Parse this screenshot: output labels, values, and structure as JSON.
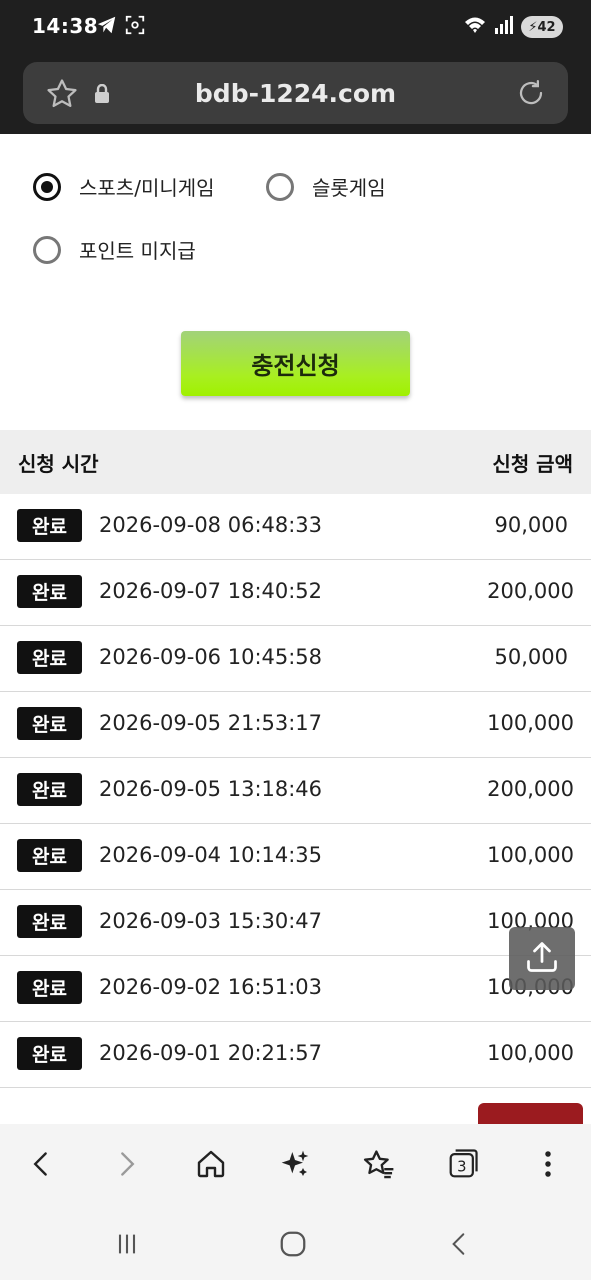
{
  "status": {
    "time": "14:38",
    "battery": "42",
    "icons": [
      "telegram-icon",
      "screenshot-icon",
      "wifi-icon",
      "signal-icon",
      "battery-icon"
    ]
  },
  "browser": {
    "url": "bdb-1224.com",
    "tab_count": "3"
  },
  "options": [
    {
      "label": "스포츠/미니게임",
      "checked": true
    },
    {
      "label": "슬롯게임",
      "checked": false
    },
    {
      "label": "포인트 미지급",
      "checked": false
    }
  ],
  "charge_button": "충전신청",
  "table": {
    "header_time": "신청 시간",
    "header_amount": "신청 금액",
    "rows": [
      {
        "status": "완료",
        "time": "2026-09-08 06:48:33",
        "amount": "90,000"
      },
      {
        "status": "완료",
        "time": "2026-09-07 18:40:52",
        "amount": "200,000"
      },
      {
        "status": "완료",
        "time": "2026-09-06 10:45:58",
        "amount": "50,000"
      },
      {
        "status": "완료",
        "time": "2026-09-05 21:53:17",
        "amount": "100,000"
      },
      {
        "status": "완료",
        "time": "2026-09-05 13:18:46",
        "amount": "200,000"
      },
      {
        "status": "완료",
        "time": "2026-09-04 10:14:35",
        "amount": "100,000"
      },
      {
        "status": "완료",
        "time": "2026-09-03 15:30:47",
        "amount": "100,000"
      },
      {
        "status": "완료",
        "time": "2026-09-02 16:51:03",
        "amount": "100,000"
      },
      {
        "status": "완료",
        "time": "2026-09-01 20:21:57",
        "amount": "100,000"
      }
    ]
  },
  "colors": {
    "accent_green": "#a8ef20",
    "badge": "#111111",
    "red_tab": "#9b1b1f"
  }
}
